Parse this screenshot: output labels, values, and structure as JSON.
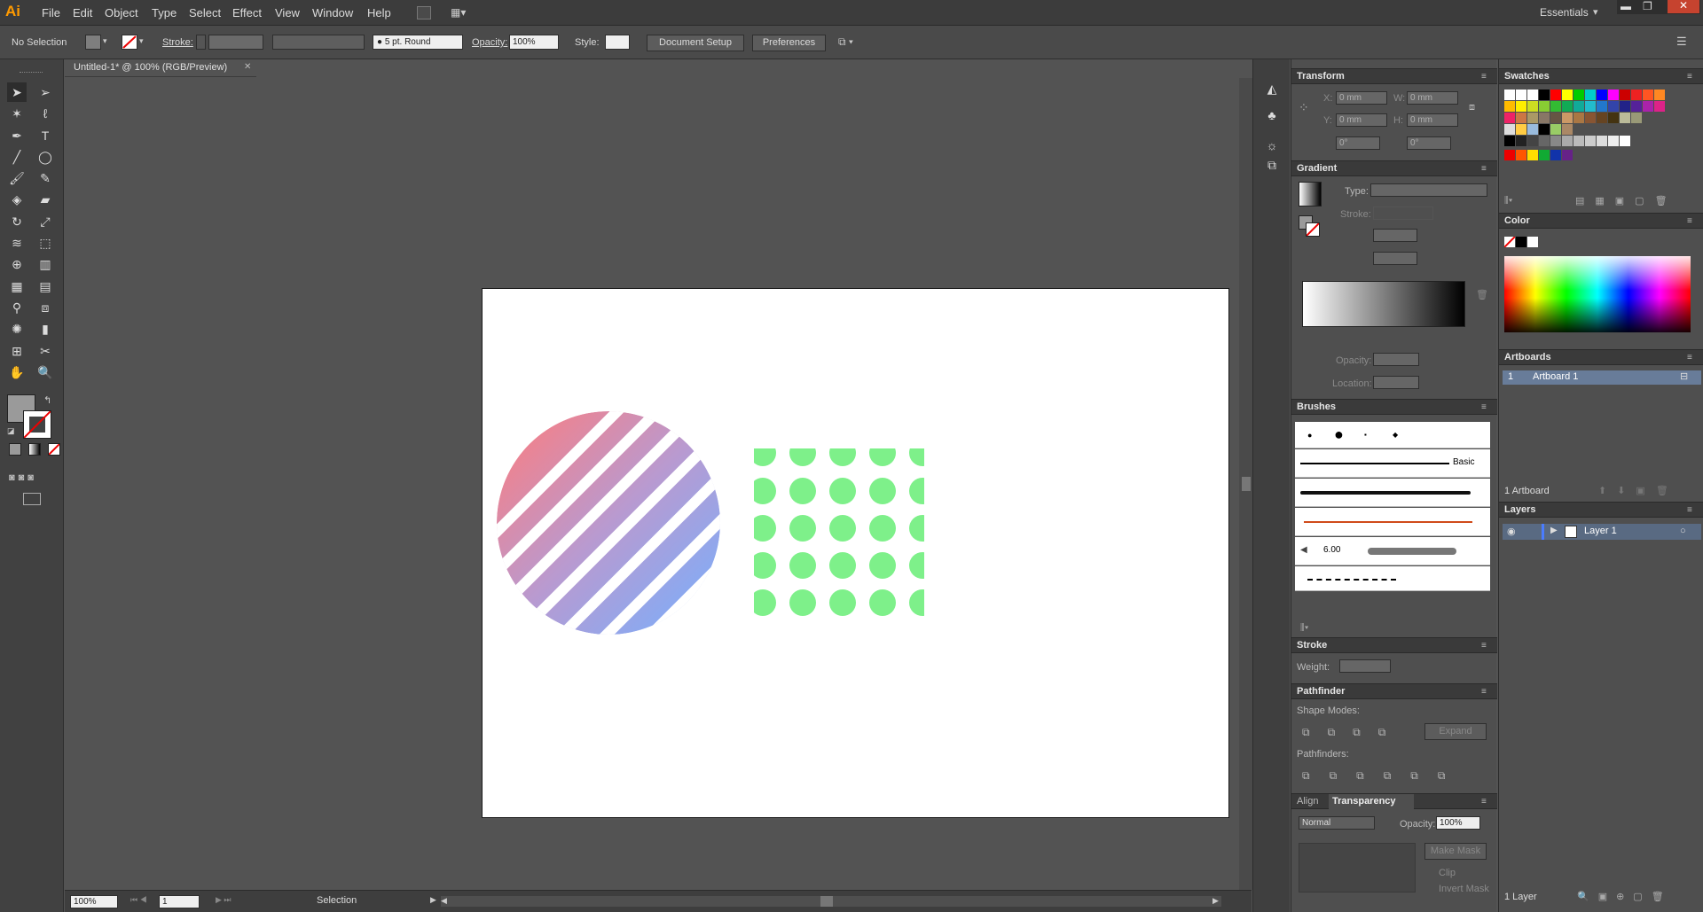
{
  "app": {
    "logo": "Ai",
    "workspace": "Essentials"
  },
  "menu": [
    "File",
    "Edit",
    "Object",
    "Type",
    "Select",
    "Effect",
    "View",
    "Window",
    "Help"
  ],
  "control": {
    "selection": "No Selection",
    "stroke_label": "Stroke:",
    "brush": "5 pt. Round",
    "opacity_label": "Opacity:",
    "opacity_value": "100%",
    "style_label": "Style:",
    "doc_setup": "Document Setup",
    "preferences": "Preferences"
  },
  "document": {
    "tab_title": "Untitled-1* @ 100% (RGB/Preview)"
  },
  "status": {
    "zoom": "100%",
    "artboard_num": "1",
    "tool": "Selection"
  },
  "transform": {
    "title": "Transform",
    "x_label": "X:",
    "x": "0 mm",
    "y_label": "Y:",
    "y": "0 mm",
    "w_label": "W:",
    "w": "0 mm",
    "h_label": "H:",
    "h": "0 mm",
    "angle": "0°",
    "shear": "0°"
  },
  "gradient": {
    "title": "Gradient",
    "type_label": "Type:",
    "stroke_label": "Stroke:",
    "opacity_label": "Opacity:",
    "location_label": "Location:"
  },
  "brushes": {
    "title": "Brushes",
    "basic": "Basic",
    "size_value": "6.00"
  },
  "stroke": {
    "title": "Stroke",
    "weight_label": "Weight:"
  },
  "pathfinder": {
    "title": "Pathfinder",
    "shape_modes": "Shape Modes:",
    "expand": "Expand",
    "pathfinders": "Pathfinders:"
  },
  "transparency": {
    "align_tab": "Align",
    "title": "Transparency",
    "mode": "Normal",
    "opacity_label": "Opacity:",
    "opacity": "100%",
    "make_mask": "Make Mask",
    "clip": "Clip",
    "invert": "Invert Mask"
  },
  "swatches": {
    "title": "Swatches"
  },
  "color": {
    "title": "Color"
  },
  "artboards": {
    "title": "Artboards",
    "row_num": "1",
    "row_name": "Artboard 1",
    "count": "1 Artboard"
  },
  "layers": {
    "title": "Layers",
    "layer_name": "Layer 1",
    "count": "1 Layer"
  },
  "colors": {
    "stripe_from": "#ff7b7b",
    "stripe_to": "#75b0ff",
    "dots": "#7ef08a",
    "accent": "#ff9a00"
  }
}
